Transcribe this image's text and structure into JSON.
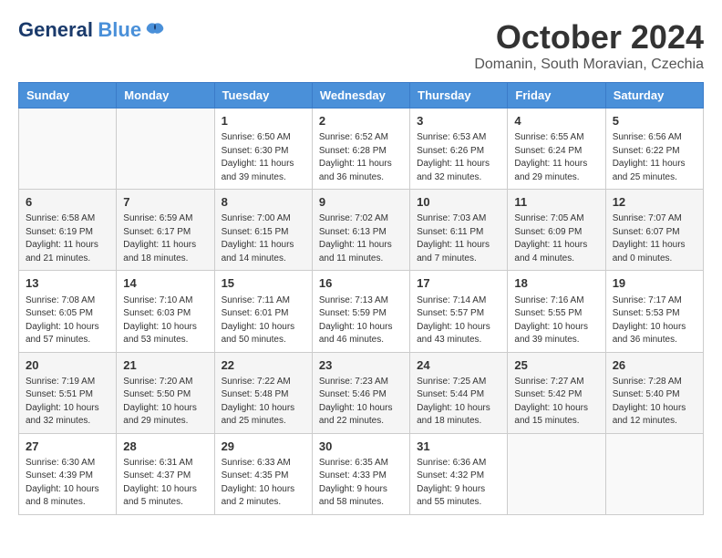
{
  "header": {
    "logo_general": "General",
    "logo_blue": "Blue",
    "month": "October 2024",
    "location": "Domanin, South Moravian, Czechia"
  },
  "weekdays": [
    "Sunday",
    "Monday",
    "Tuesday",
    "Wednesday",
    "Thursday",
    "Friday",
    "Saturday"
  ],
  "weeks": [
    [
      {
        "day": "",
        "info": ""
      },
      {
        "day": "",
        "info": ""
      },
      {
        "day": "1",
        "info": "Sunrise: 6:50 AM\nSunset: 6:30 PM\nDaylight: 11 hours\nand 39 minutes."
      },
      {
        "day": "2",
        "info": "Sunrise: 6:52 AM\nSunset: 6:28 PM\nDaylight: 11 hours\nand 36 minutes."
      },
      {
        "day": "3",
        "info": "Sunrise: 6:53 AM\nSunset: 6:26 PM\nDaylight: 11 hours\nand 32 minutes."
      },
      {
        "day": "4",
        "info": "Sunrise: 6:55 AM\nSunset: 6:24 PM\nDaylight: 11 hours\nand 29 minutes."
      },
      {
        "day": "5",
        "info": "Sunrise: 6:56 AM\nSunset: 6:22 PM\nDaylight: 11 hours\nand 25 minutes."
      }
    ],
    [
      {
        "day": "6",
        "info": "Sunrise: 6:58 AM\nSunset: 6:19 PM\nDaylight: 11 hours\nand 21 minutes."
      },
      {
        "day": "7",
        "info": "Sunrise: 6:59 AM\nSunset: 6:17 PM\nDaylight: 11 hours\nand 18 minutes."
      },
      {
        "day": "8",
        "info": "Sunrise: 7:00 AM\nSunset: 6:15 PM\nDaylight: 11 hours\nand 14 minutes."
      },
      {
        "day": "9",
        "info": "Sunrise: 7:02 AM\nSunset: 6:13 PM\nDaylight: 11 hours\nand 11 minutes."
      },
      {
        "day": "10",
        "info": "Sunrise: 7:03 AM\nSunset: 6:11 PM\nDaylight: 11 hours\nand 7 minutes."
      },
      {
        "day": "11",
        "info": "Sunrise: 7:05 AM\nSunset: 6:09 PM\nDaylight: 11 hours\nand 4 minutes."
      },
      {
        "day": "12",
        "info": "Sunrise: 7:07 AM\nSunset: 6:07 PM\nDaylight: 11 hours\nand 0 minutes."
      }
    ],
    [
      {
        "day": "13",
        "info": "Sunrise: 7:08 AM\nSunset: 6:05 PM\nDaylight: 10 hours\nand 57 minutes."
      },
      {
        "day": "14",
        "info": "Sunrise: 7:10 AM\nSunset: 6:03 PM\nDaylight: 10 hours\nand 53 minutes."
      },
      {
        "day": "15",
        "info": "Sunrise: 7:11 AM\nSunset: 6:01 PM\nDaylight: 10 hours\nand 50 minutes."
      },
      {
        "day": "16",
        "info": "Sunrise: 7:13 AM\nSunset: 5:59 PM\nDaylight: 10 hours\nand 46 minutes."
      },
      {
        "day": "17",
        "info": "Sunrise: 7:14 AM\nSunset: 5:57 PM\nDaylight: 10 hours\nand 43 minutes."
      },
      {
        "day": "18",
        "info": "Sunrise: 7:16 AM\nSunset: 5:55 PM\nDaylight: 10 hours\nand 39 minutes."
      },
      {
        "day": "19",
        "info": "Sunrise: 7:17 AM\nSunset: 5:53 PM\nDaylight: 10 hours\nand 36 minutes."
      }
    ],
    [
      {
        "day": "20",
        "info": "Sunrise: 7:19 AM\nSunset: 5:51 PM\nDaylight: 10 hours\nand 32 minutes."
      },
      {
        "day": "21",
        "info": "Sunrise: 7:20 AM\nSunset: 5:50 PM\nDaylight: 10 hours\nand 29 minutes."
      },
      {
        "day": "22",
        "info": "Sunrise: 7:22 AM\nSunset: 5:48 PM\nDaylight: 10 hours\nand 25 minutes."
      },
      {
        "day": "23",
        "info": "Sunrise: 7:23 AM\nSunset: 5:46 PM\nDaylight: 10 hours\nand 22 minutes."
      },
      {
        "day": "24",
        "info": "Sunrise: 7:25 AM\nSunset: 5:44 PM\nDaylight: 10 hours\nand 18 minutes."
      },
      {
        "day": "25",
        "info": "Sunrise: 7:27 AM\nSunset: 5:42 PM\nDaylight: 10 hours\nand 15 minutes."
      },
      {
        "day": "26",
        "info": "Sunrise: 7:28 AM\nSunset: 5:40 PM\nDaylight: 10 hours\nand 12 minutes."
      }
    ],
    [
      {
        "day": "27",
        "info": "Sunrise: 6:30 AM\nSunset: 4:39 PM\nDaylight: 10 hours\nand 8 minutes."
      },
      {
        "day": "28",
        "info": "Sunrise: 6:31 AM\nSunset: 4:37 PM\nDaylight: 10 hours\nand 5 minutes."
      },
      {
        "day": "29",
        "info": "Sunrise: 6:33 AM\nSunset: 4:35 PM\nDaylight: 10 hours\nand 2 minutes."
      },
      {
        "day": "30",
        "info": "Sunrise: 6:35 AM\nSunset: 4:33 PM\nDaylight: 9 hours\nand 58 minutes."
      },
      {
        "day": "31",
        "info": "Sunrise: 6:36 AM\nSunset: 4:32 PM\nDaylight: 9 hours\nand 55 minutes."
      },
      {
        "day": "",
        "info": ""
      },
      {
        "day": "",
        "info": ""
      }
    ]
  ]
}
